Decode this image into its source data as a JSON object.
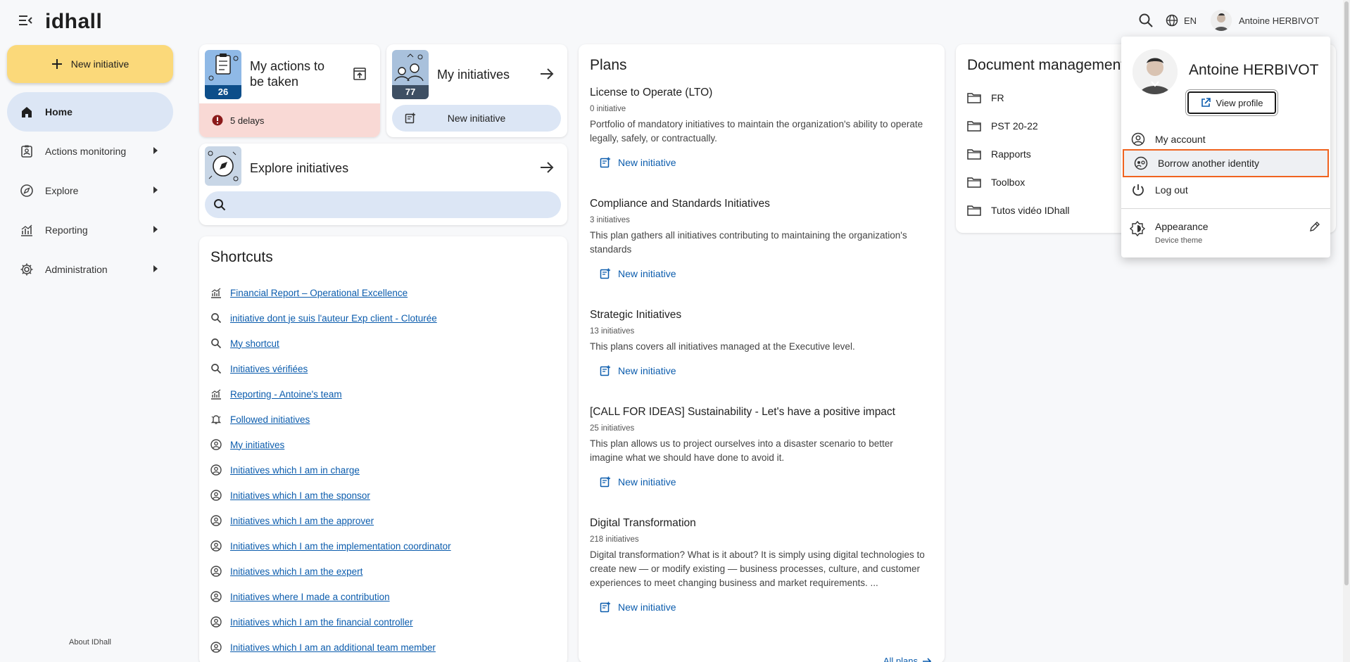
{
  "app": {
    "logo": "idhall"
  },
  "topbar": {
    "lang": "EN",
    "user_name": "Antoine HERBIVOT"
  },
  "sidebar": {
    "new_initiative": "New initiative",
    "items": [
      {
        "label": "Home",
        "icon": "home-icon",
        "active": true
      },
      {
        "label": "Actions monitoring",
        "icon": "clipboard-user-icon"
      },
      {
        "label": "Explore",
        "icon": "compass-icon"
      },
      {
        "label": "Reporting",
        "icon": "chart-icon"
      },
      {
        "label": "Administration",
        "icon": "gear-icon"
      }
    ],
    "about": "About IDhall"
  },
  "cards": {
    "actions": {
      "title": "My actions to be taken",
      "count": "26",
      "delays": "5 delays"
    },
    "initiatives": {
      "title": "My initiatives",
      "count": "77",
      "new_label": "New initiative"
    },
    "explore": {
      "title": "Explore initiatives",
      "search_placeholder": ""
    }
  },
  "shortcuts": {
    "title": "Shortcuts",
    "items": [
      {
        "label": "Financial Report – Operational Excellence",
        "icon": "chart-icon"
      },
      {
        "label": "initiative dont je suis l'auteur Exp client - Cloturée",
        "icon": "search-icon"
      },
      {
        "label": "My shortcut",
        "icon": "search-icon"
      },
      {
        "label": "Initiatives vérifiées",
        "icon": "search-icon"
      },
      {
        "label": "Reporting - Antoine's team",
        "icon": "chart-icon"
      },
      {
        "label": "Followed initiatives",
        "icon": "bell-icon"
      },
      {
        "label": "My initiatives",
        "icon": "user-circle-icon"
      },
      {
        "label": "Initiatives which I am in charge",
        "icon": "user-circle-icon"
      },
      {
        "label": "Initiatives which I am the sponsor",
        "icon": "user-circle-icon"
      },
      {
        "label": "Initiatives which I am the approver",
        "icon": "user-circle-icon"
      },
      {
        "label": "Initiatives which I am the implementation coordinator",
        "icon": "user-circle-icon"
      },
      {
        "label": "Initiatives which I am the expert",
        "icon": "user-circle-icon"
      },
      {
        "label": "Initiatives where I made a contribution",
        "icon": "user-circle-icon"
      },
      {
        "label": "Initiatives which I am the financial controller",
        "icon": "user-circle-icon"
      },
      {
        "label": "Initiatives which I am an additional team member",
        "icon": "user-circle-icon"
      }
    ]
  },
  "plans": {
    "title": "Plans",
    "new_label": "New initiative",
    "all_plans": "All plans",
    "items": [
      {
        "title": "License to Operate (LTO)",
        "count": "0 initiative",
        "description": "Portfolio of mandatory initiatives to maintain the organization's ability to operate legally, safely, or contractually."
      },
      {
        "title": "Compliance and Standards Initiatives",
        "count": "3 initiatives",
        "description": "This plan gathers all initiatives contributing to maintaining the organization's standards"
      },
      {
        "title": "Strategic Initiatives",
        "count": "13 initiatives",
        "description": "This plans covers all initiatives managed at the Executive level."
      },
      {
        "title": "[CALL FOR IDEAS] Sustainability - Let's have a positive impact",
        "count": "25 initiatives",
        "description": "This plan allows us to project ourselves into a disaster scenario to better imagine what we should have done to avoid it."
      },
      {
        "title": "Digital Transformation",
        "count": "218 initiatives",
        "description": "Digital transformation? What is it about? It is simply using digital technologies to create new — or modify existing — business processes, culture, and customer experiences to meet changing business and market requirements. ..."
      }
    ]
  },
  "documents": {
    "title": "Document management",
    "items": [
      "FR",
      "PST 20-22",
      "Rapports",
      "Toolbox",
      "Tutos vidéo IDhall"
    ]
  },
  "user_menu": {
    "name": "Antoine HERBIVOT",
    "view_profile": "View profile",
    "my_account": "My account",
    "borrow_identity": "Borrow another identity",
    "logout": "Log out",
    "appearance": "Appearance",
    "appearance_sub": "Device theme"
  },
  "colors": {
    "accent": "#0b5cad",
    "new_button": "#fbd97a",
    "active_nav": "#dce6f5",
    "delays_bg": "#f9d9d5",
    "highlight_border": "#f0631f"
  }
}
